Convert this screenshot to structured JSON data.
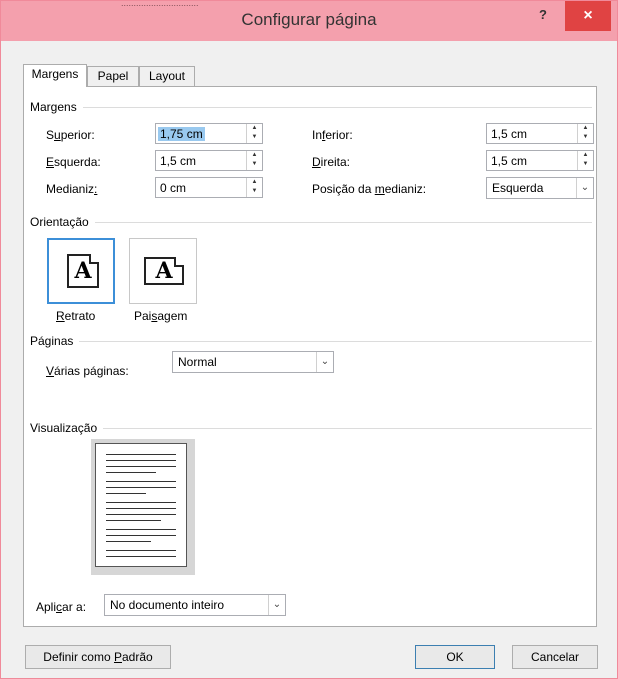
{
  "window": {
    "title": "Configurar página",
    "top_strip_text": "...............................",
    "help_label": "?",
    "close_label": "×"
  },
  "tabs": [
    {
      "label": "Margens",
      "active": true
    },
    {
      "label": "Papel",
      "active": false
    },
    {
      "label": "Layout",
      "active": false
    }
  ],
  "margins": {
    "section_label": "Margens",
    "superior": {
      "pre": "S",
      "u": "u",
      "post": "perior:",
      "value": "1,75 cm"
    },
    "inferior": {
      "pre": "In",
      "u": "f",
      "post": "erior:",
      "value": "1,5 cm"
    },
    "esquerda": {
      "pre": "",
      "u": "E",
      "post": "squerda:",
      "value": "1,5 cm"
    },
    "direita": {
      "pre": "",
      "u": "D",
      "post": "ireita:",
      "value": "1,5 cm"
    },
    "medianiz": {
      "pre": "Medianiz",
      "u": ":",
      "post": "",
      "value": "0 cm"
    },
    "posicao": {
      "pre": "Posição da ",
      "u": "m",
      "post": "edianiz:",
      "value": "Esquerda"
    }
  },
  "orientation": {
    "section_label": "Orientação",
    "icon_letter": "A",
    "retrato": {
      "pre": "",
      "u": "R",
      "post": "etrato"
    },
    "paisagem": {
      "pre": "Pai",
      "u": "s",
      "post": "agem"
    }
  },
  "pages": {
    "section_label": "Páginas",
    "multiple": {
      "pre": "",
      "u": "V",
      "post": "árias páginas:",
      "value": "Normal"
    }
  },
  "preview": {
    "section_label": "Visualização"
  },
  "apply": {
    "pre": "Apli",
    "u": "c",
    "post": "ar a:",
    "value": "No documento inteiro"
  },
  "buttons": {
    "default": {
      "pre": "Definir como ",
      "u": "P",
      "post": "adrão"
    },
    "ok": "OK",
    "cancel": "Cancelar"
  },
  "colors": {
    "titlebar": "#f4a0ad",
    "close": "#e04343",
    "selection": "#99c9ef",
    "active_border": "#3c8fd8"
  }
}
